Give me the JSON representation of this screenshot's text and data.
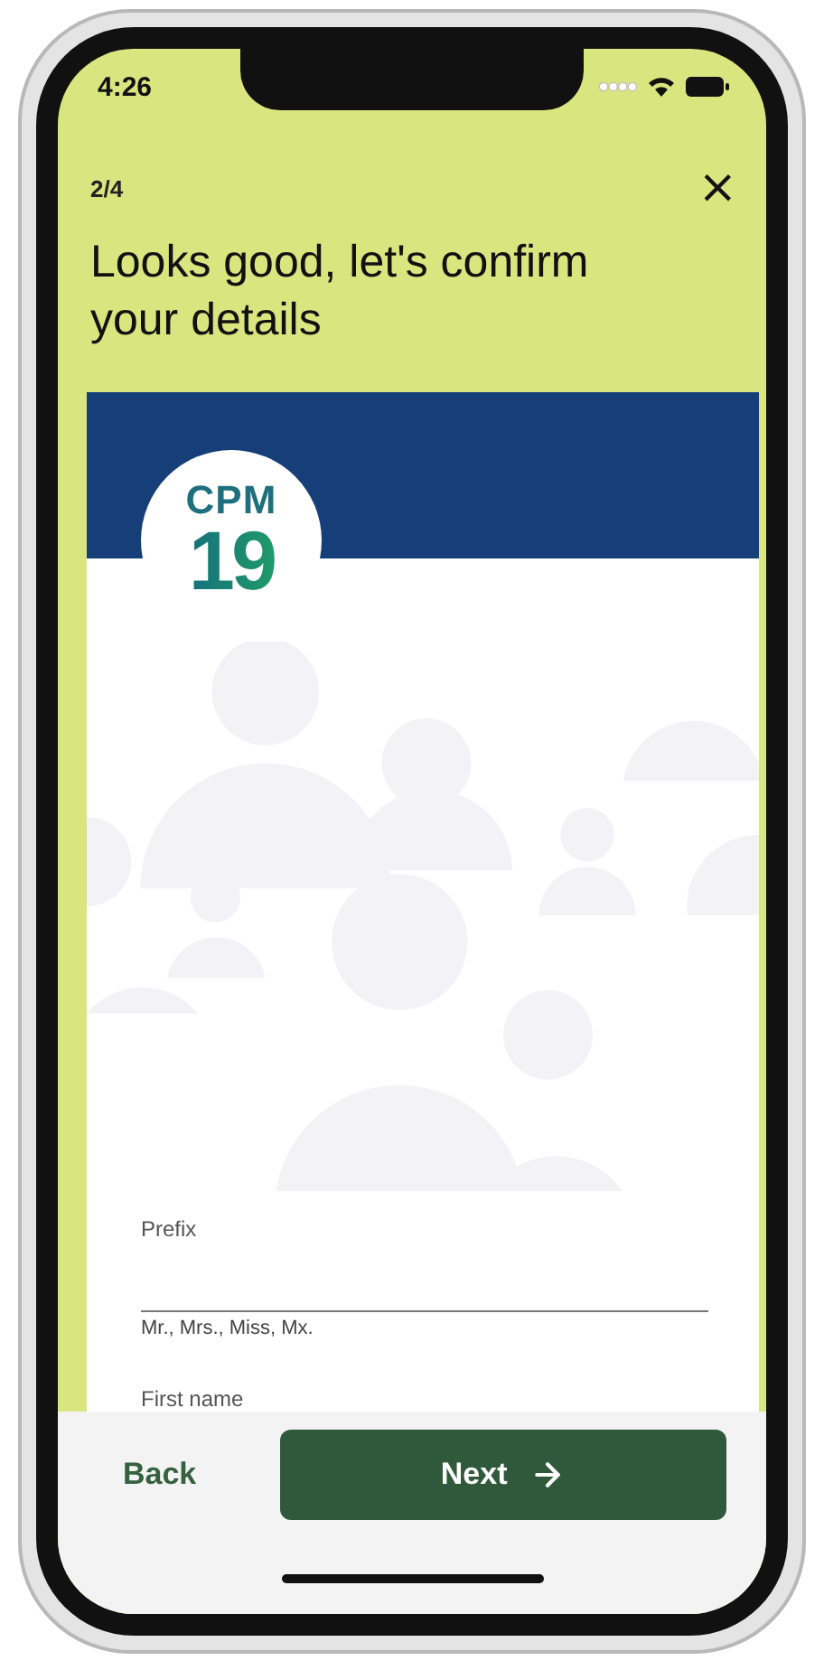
{
  "status_bar": {
    "time": "4:26"
  },
  "header": {
    "step": "2/4",
    "close": "×",
    "title": "Looks good, let's confirm your details"
  },
  "card": {
    "logo": {
      "line1": "CPM",
      "line2": "19"
    }
  },
  "form": {
    "fields": [
      {
        "label": "Prefix",
        "helper": "Mr., Mrs., Miss, Mx."
      },
      {
        "label": "First name"
      }
    ]
  },
  "footer": {
    "back": "Back",
    "next": "Next"
  }
}
